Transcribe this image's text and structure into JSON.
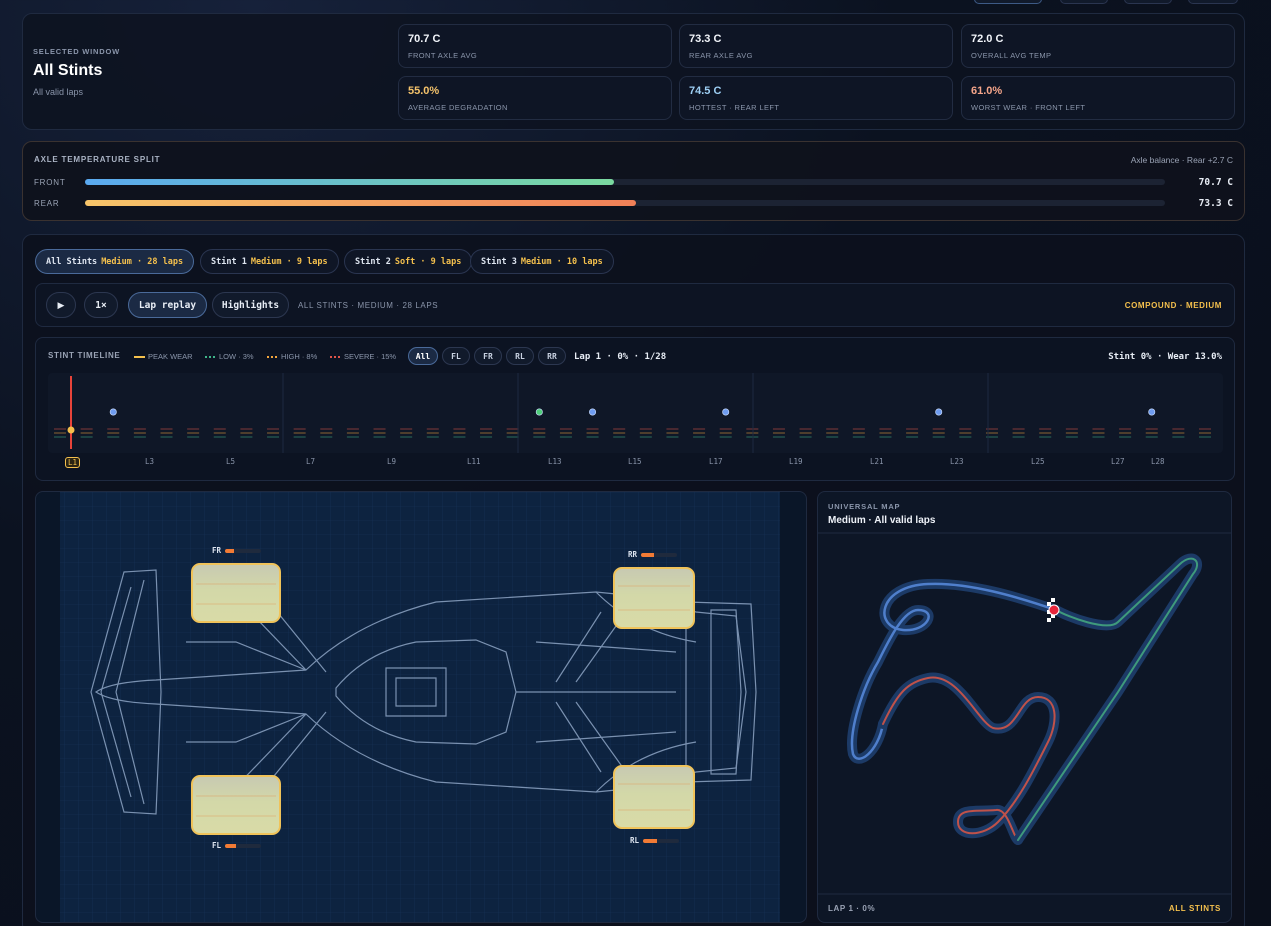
{
  "summary": {
    "selected_label": "SELECTED WINDOW",
    "title": "All Stints",
    "subtitle": "All valid laps",
    "stats": [
      {
        "value": "70.7 C",
        "label": "FRONT AXLE AVG",
        "color": "#f2f5fa"
      },
      {
        "value": "73.3 C",
        "label": "REAR AXLE AVG",
        "color": "#f2f5fa"
      },
      {
        "value": "72.0 C",
        "label": "OVERALL AVG TEMP",
        "color": "#f2f5fa"
      },
      {
        "value": "55.0%",
        "label": "AVERAGE DEGRADATION",
        "color": "#f5c36b"
      },
      {
        "value": "74.5 C",
        "label": "HOTTEST · REAR LEFT",
        "color": "#9ed0f5"
      },
      {
        "value": "61.0%",
        "label": "WORST WEAR · FRONT LEFT",
        "color": "#f5a58a"
      }
    ]
  },
  "axle": {
    "title": "AXLE TEMPERATURE SPLIT",
    "balance": "Axle balance · Rear +2.7 C",
    "front_label": "FRONT",
    "front_value": "70.7 C",
    "front_fraction": 0.49,
    "rear_label": "REAR",
    "rear_value": "73.3 C",
    "rear_fraction": 0.51
  },
  "stint_tabs": [
    {
      "name": "All Stints",
      "detail": "Medium · 28 laps",
      "active": true
    },
    {
      "name": "Stint 1",
      "detail": "Medium · 9 laps",
      "active": false
    },
    {
      "name": "Stint 2",
      "detail": "Soft · 9 laps",
      "active": false
    },
    {
      "name": "Stint 3",
      "detail": "Medium · 10 laps",
      "active": false
    }
  ],
  "controls": {
    "play_icon": "play-icon",
    "play_glyph": "▶",
    "speed": "1×",
    "lap_replay": "Lap replay",
    "highlights": "Highlights",
    "info": "ALL STINTS · MEDIUM · 28 LAPS",
    "compound": "COMPOUND · MEDIUM"
  },
  "timeline": {
    "title": "STINT TIMELINE",
    "legend": [
      {
        "label": "PEAK WEAR",
        "color": "#f4c04d"
      },
      {
        "label": "LOW · 3%",
        "color": "#3fb58a"
      },
      {
        "label": "HIGH · 8%",
        "color": "#f4a63d"
      },
      {
        "label": "SEVERE · 15%",
        "color": "#e0554a"
      }
    ],
    "tire_buttons": [
      "All",
      "FL",
      "FR",
      "RL",
      "RR"
    ],
    "active_tire": "All",
    "lap_status": "Lap 1 · 0% · 1/28",
    "stint_status": "Stint 0% · Wear 13.0%",
    "lap_labels": [
      "L1",
      "L3",
      "L5",
      "L7",
      "L9",
      "L11",
      "L13",
      "L15",
      "L17",
      "L19",
      "L21",
      "L23",
      "L25",
      "L27",
      "L28"
    ],
    "lap_count": 28,
    "event_laps": [
      {
        "lap": 3,
        "color": "#6f9cf0"
      },
      {
        "lap": 19,
        "color": "#4fcf7a"
      },
      {
        "lap": 21,
        "color": "#6f9cf0"
      },
      {
        "lap": 26,
        "color": "#6f9cf0"
      },
      {
        "lap": 34,
        "color": "#6f9cf0"
      },
      {
        "lap": 42,
        "color": "#6f9cf0"
      }
    ]
  },
  "car": {
    "tires": [
      {
        "id": "FR",
        "label": "FR",
        "wear": 0.25
      },
      {
        "id": "RR",
        "label": "RR",
        "wear": 0.35
      },
      {
        "id": "FL",
        "label": "FL",
        "wear": 0.3
      },
      {
        "id": "RL",
        "label": "RL",
        "wear": 0.4
      }
    ]
  },
  "map": {
    "label": "UNIVERSAL MAP",
    "title": "Medium · All valid laps",
    "footer_left": "LAP 1 · 0%",
    "footer_right": "ALL STINTS"
  }
}
